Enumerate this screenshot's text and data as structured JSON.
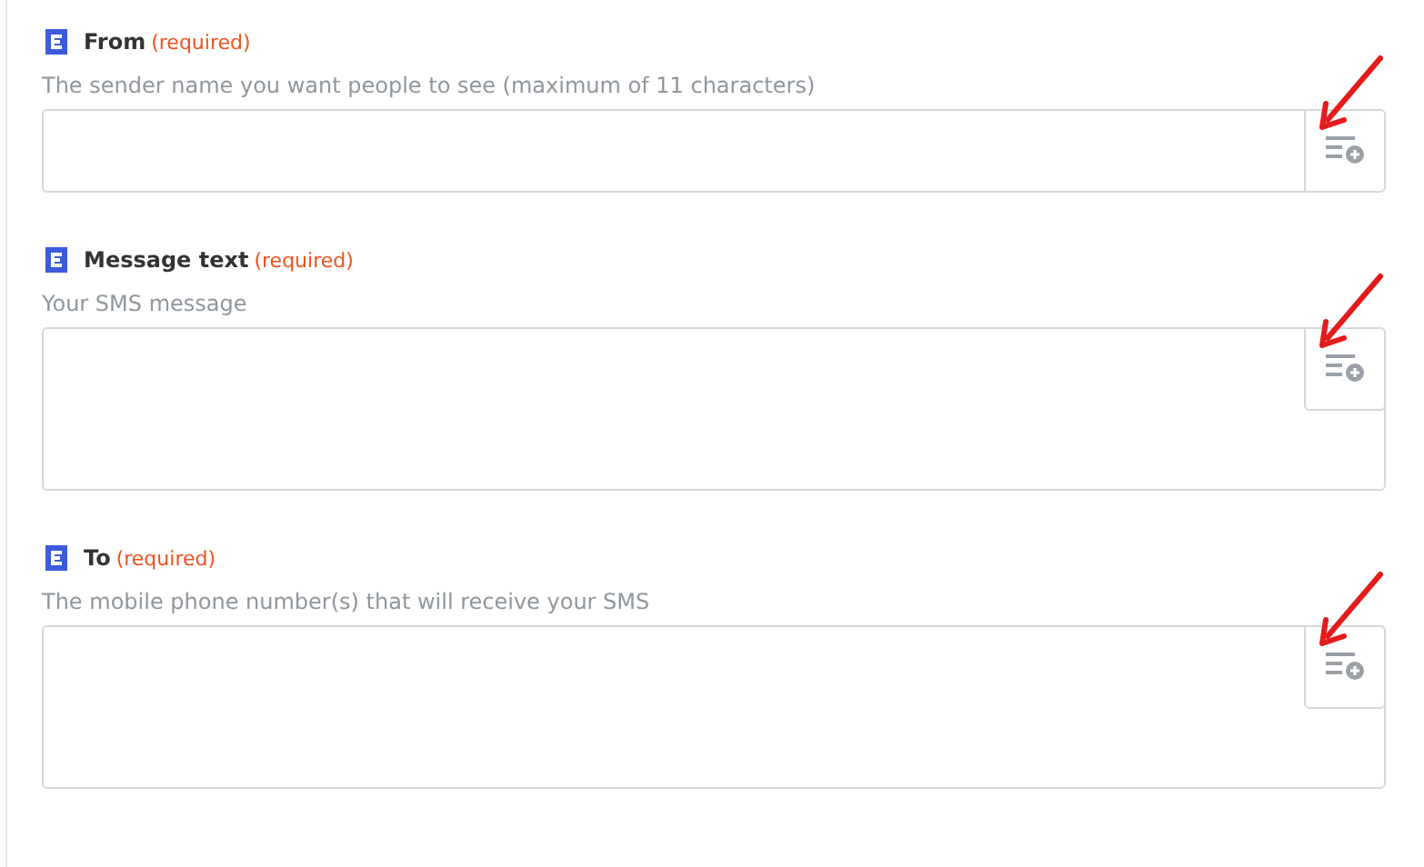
{
  "fields": [
    {
      "label": "From",
      "required_note": "(required)",
      "hint": "The sender name you want people to see (maximum of 11 characters)",
      "kind": "single",
      "arrow": true
    },
    {
      "label": "Message text",
      "required_note": "(required)",
      "hint": "Your SMS message",
      "kind": "multi",
      "arrow": true
    },
    {
      "label": "To",
      "required_note": "(required)",
      "hint": "The mobile phone number(s) that will receive your SMS",
      "kind": "multi",
      "arrow": true
    }
  ]
}
